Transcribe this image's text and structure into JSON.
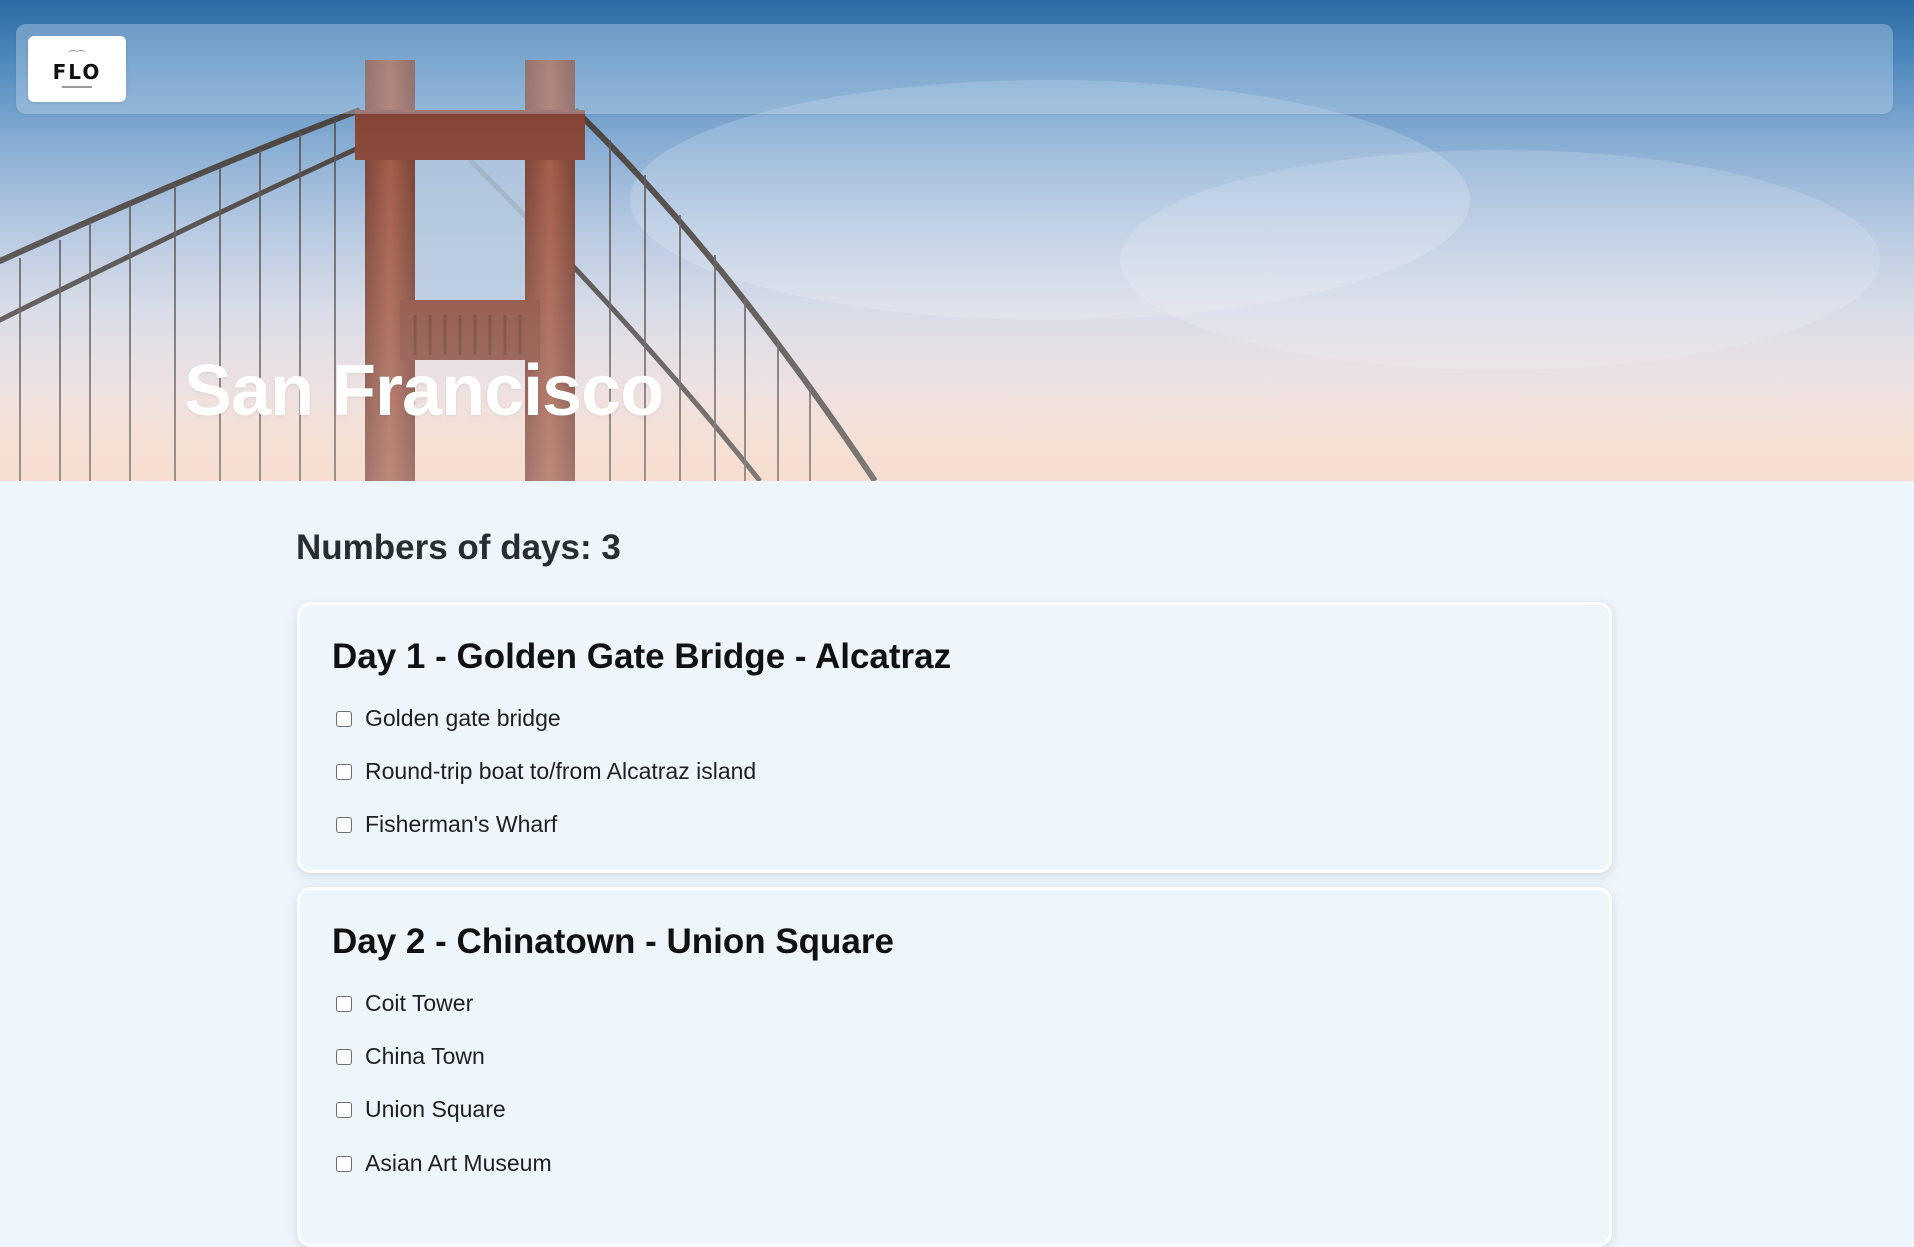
{
  "logo": {
    "text": "FLO"
  },
  "hero": {
    "title": "San Francisco"
  },
  "summary": {
    "days_label": "Numbers of days: 3"
  },
  "days": [
    {
      "title": "Day 1 - Golden Gate Bridge - Alcatraz",
      "tasks": [
        {
          "label": "Golden gate bridge",
          "checked": false
        },
        {
          "label": "Round-trip boat to/from Alcatraz island",
          "checked": false
        },
        {
          "label": "Fisherman's Wharf",
          "checked": false
        }
      ]
    },
    {
      "title": "Day 2 - Chinatown - Union Square",
      "tasks": [
        {
          "label": "Coit Tower",
          "checked": false
        },
        {
          "label": "China Town",
          "checked": false
        },
        {
          "label": "Union Square",
          "checked": false
        },
        {
          "label": "Asian Art Museum",
          "checked": false
        }
      ]
    }
  ],
  "colors": {
    "page_background": "#eef5fb",
    "bridge": "#8a3f2c",
    "hero_sky_top": "#2a6aa4",
    "hero_sky_bottom": "#f3cdb6"
  }
}
